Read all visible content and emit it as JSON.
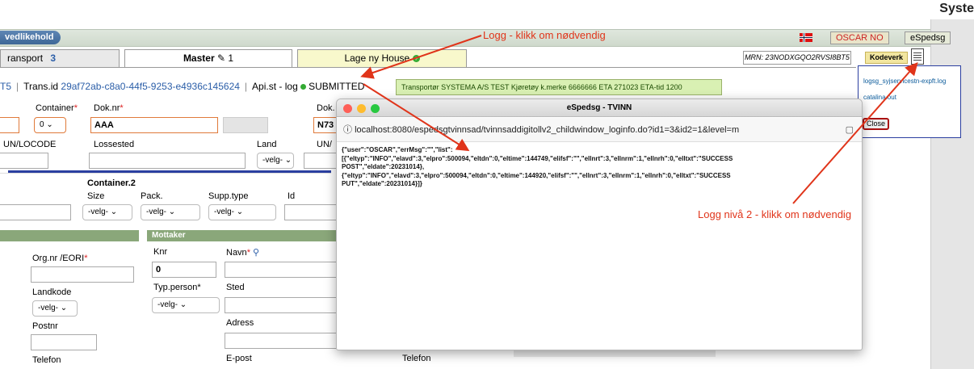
{
  "top": {
    "right_title": "Syste"
  },
  "header": {
    "vedlikehold_label": "vedlikehold",
    "user_label": "OSCAR NO",
    "app_label": "eSpedsg"
  },
  "tabs": {
    "transport": {
      "label": "ransport",
      "count": "3"
    },
    "master": {
      "label": "Master",
      "count": "1"
    },
    "house": {
      "label": "Lage ny House"
    }
  },
  "mrn": "MRN: 23NODXGQO2RVSI8BT5",
  "kodeverk": "Kodeverk",
  "log_panel": {
    "link1": "logsg_syjservicestn-expft.log",
    "link2": "catalina.out",
    "close": "Close"
  },
  "trans_row": {
    "prefix": "T5",
    "trans_label": "Trans.id",
    "trans_id": "29af72ab-c8a0-44f5-9253-e4936c145624",
    "api_label": "Api.st - log",
    "status": "SUBMITTED"
  },
  "transport_box": "Transportør SYSTEMA A/S TEST  Kjøretøy k.merke 6666666  ETA 271023  ETA-tid 1200",
  "form": {
    "container_label": "Container",
    "container_value": "0",
    "doknr_label": "Dok.nr",
    "doknr_value": "AAA",
    "dok_label2": "Dok.",
    "n73_value": "N73",
    "unlocode_label": "UN/LOCODE",
    "lossested_label": "Lossested",
    "land_label": "Land",
    "land_value": "-velg-",
    "un_label2": "UN/",
    "container2_label": "Container.2",
    "size_label": "Size",
    "size_value": "-velg-",
    "pack_label": "Pack.",
    "pack_value": "-velg-",
    "supp_label": "Supp.type",
    "supp_value": "-velg-",
    "id_label": "Id",
    "orgnr_label": "Org.nr /EORI",
    "landkode_label": "Landkode",
    "landkode_value": "-velg-",
    "postnr_label": "Postnr",
    "telefon_label": "Telefon",
    "mottaker_label": "Mottaker",
    "knr_label": "Knr",
    "knr_value": "0",
    "navn_label": "Navn",
    "typperson_label": "Typ.person",
    "typperson_value": "-velg-",
    "sted_label": "Sted",
    "adress_label": "Adress",
    "epost_label": "E-post",
    "telefon2_label": "Telefon"
  },
  "popup": {
    "title": "eSpedsg - TVINN",
    "url": "localhost:8080/espedsgtvinnsad/tvinnsaddigitollv2_childwindow_loginfo.do?id1=3&id2=1&level=m",
    "lines": [
      "{\"user\":\"OSCAR\",\"errMsg\":\"\",\"list\":",
      "[{\"eltyp\":\"INFO\",\"elavd\":3,\"elpro\":500094,\"eltdn\":0,\"eltime\":144749,\"elifsf\":\"\",\"ellnrt\":3,\"ellnrm\":1,\"ellnrh\":0,\"elltxt\":\"SUCCESS",
      "POST\",\"eldate\":20231014},",
      "{\"eltyp\":\"INFO\",\"elavd\":3,\"elpro\":500094,\"eltdn\":0,\"eltime\":144920,\"elifsf\":\"\",\"ellnrt\":3,\"ellnrm\":1,\"ellnrh\":0,\"elltxt\":\"SUCCESS",
      "PUT\",\"eldate\":20231014}]}"
    ]
  },
  "annotations": {
    "logg1": "Logg - klikk om nødvendig",
    "logg2": "Logg nivå 2 - klikk om nødvendig"
  },
  "colors": {
    "annotation": "#e0341a",
    "status_green": "#33aa33"
  }
}
